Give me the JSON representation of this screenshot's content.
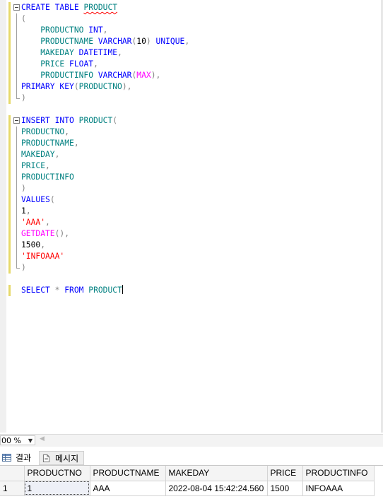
{
  "editor": {
    "lines": [
      [
        [
          "kw",
          "CREATE"
        ],
        [
          "t",
          " "
        ],
        [
          "kw",
          "TABLE"
        ],
        [
          "t",
          " "
        ],
        [
          "sq",
          "PRODUCT"
        ]
      ],
      [
        [
          "pu",
          "("
        ]
      ],
      [
        [
          "t",
          "    "
        ],
        [
          "id",
          "PRODUCTNO"
        ],
        [
          "t",
          " "
        ],
        [
          "ty",
          "INT"
        ],
        [
          "pu",
          ","
        ]
      ],
      [
        [
          "t",
          "    "
        ],
        [
          "id",
          "PRODUCTNAME"
        ],
        [
          "t",
          " "
        ],
        [
          "ty",
          "VARCHAR"
        ],
        [
          "pu",
          "("
        ],
        [
          "num",
          "10"
        ],
        [
          "pu",
          ")"
        ],
        [
          "t",
          " "
        ],
        [
          "kw",
          "UNIQUE"
        ],
        [
          "pu",
          ","
        ]
      ],
      [
        [
          "t",
          "    "
        ],
        [
          "id",
          "MAKEDAY"
        ],
        [
          "t",
          " "
        ],
        [
          "ty",
          "DATETIME"
        ],
        [
          "pu",
          ","
        ]
      ],
      [
        [
          "t",
          "    "
        ],
        [
          "id",
          "PRICE"
        ],
        [
          "t",
          " "
        ],
        [
          "ty",
          "FLOAT"
        ],
        [
          "pu",
          ","
        ]
      ],
      [
        [
          "t",
          "    "
        ],
        [
          "id",
          "PRODUCTINFO"
        ],
        [
          "t",
          " "
        ],
        [
          "ty",
          "VARCHAR"
        ],
        [
          "pu",
          "("
        ],
        [
          "fn",
          "MAX"
        ],
        [
          "pu",
          "),"
        ]
      ],
      [
        [
          "kw",
          "PRIMARY"
        ],
        [
          "t",
          " "
        ],
        [
          "kw",
          "KEY"
        ],
        [
          "pu",
          "("
        ],
        [
          "id",
          "PRODUCTNO"
        ],
        [
          "pu",
          "),"
        ]
      ],
      [
        [
          "pu",
          ")"
        ]
      ],
      [],
      [
        [
          "kw",
          "INSERT"
        ],
        [
          "t",
          " "
        ],
        [
          "kw",
          "INTO"
        ],
        [
          "t",
          " "
        ],
        [
          "id",
          "PRODUCT"
        ],
        [
          "pu",
          "("
        ]
      ],
      [
        [
          "id",
          "PRODUCTNO"
        ],
        [
          "pu",
          ","
        ]
      ],
      [
        [
          "id",
          "PRODUCTNAME"
        ],
        [
          "pu",
          ","
        ]
      ],
      [
        [
          "id",
          "MAKEDAY"
        ],
        [
          "pu",
          ","
        ]
      ],
      [
        [
          "id",
          "PRICE"
        ],
        [
          "pu",
          ","
        ]
      ],
      [
        [
          "id",
          "PRODUCTINFO"
        ]
      ],
      [
        [
          "pu",
          ")"
        ]
      ],
      [
        [
          "kw",
          "VALUES"
        ],
        [
          "pu",
          "("
        ]
      ],
      [
        [
          "num",
          "1"
        ],
        [
          "pu",
          ","
        ]
      ],
      [
        [
          "st",
          "'AAA'"
        ],
        [
          "pu",
          ","
        ]
      ],
      [
        [
          "fn",
          "GETDATE"
        ],
        [
          "pu",
          "(),"
        ]
      ],
      [
        [
          "num",
          "1500"
        ],
        [
          "pu",
          ","
        ]
      ],
      [
        [
          "st",
          "'INFOAAA'"
        ]
      ],
      [
        [
          "pu",
          ")"
        ]
      ],
      [],
      [
        [
          "kw",
          "SELECT"
        ],
        [
          "t",
          " "
        ],
        [
          "pu",
          "*"
        ],
        [
          "t",
          " "
        ],
        [
          "kw",
          "FROM"
        ],
        [
          "t",
          " "
        ],
        [
          "id",
          "PRODUCT"
        ],
        [
          "caret",
          ""
        ]
      ]
    ]
  },
  "zoom": {
    "value": "00 %"
  },
  "tabs": {
    "results_label": "결과",
    "messages_label": "메시지"
  },
  "grid": {
    "columns": [
      "PRODUCTNO",
      "PRODUCTNAME",
      "MAKEDAY",
      "PRICE",
      "PRODUCTINFO"
    ],
    "rows": [
      {
        "row_number": "1",
        "cells": [
          "1",
          "AAA",
          "2022-08-04 15:42:24.560",
          "1500",
          "INFOAAA"
        ]
      }
    ]
  },
  "icons": {
    "fold": "collapse-minus-icon",
    "results": "grid-icon",
    "messages": "document-icon",
    "zoom": "chevron-down-icon"
  }
}
